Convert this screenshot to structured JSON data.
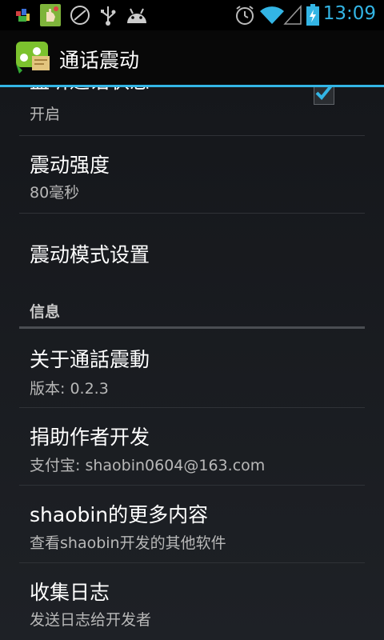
{
  "statusbar": {
    "time": "13:09",
    "left_icons": [
      "app-icon",
      "notification-icon",
      "sync-icon",
      "usb-icon",
      "android-debug-icon"
    ],
    "right_icons": [
      "alarm-icon",
      "wifi-icon",
      "signal-icon",
      "battery-icon"
    ],
    "accent": "#33b5e5"
  },
  "actionbar": {
    "title": "通话震动",
    "icon": "app-icon"
  },
  "list": {
    "partial_item": {
      "title": "监听通话状态",
      "summary": "开启",
      "checked": true
    },
    "items": [
      {
        "title": "震动强度",
        "summary": "80毫秒"
      },
      {
        "title": "震动模式设置"
      }
    ],
    "category": {
      "label": "信息"
    },
    "info_items": [
      {
        "title": "关于通話震動",
        "summary": "版本: 0.2.3"
      },
      {
        "title": "捐助作者开发",
        "summary": "支付宝: shaobin0604@163.com"
      },
      {
        "title": "shaobin的更多内容",
        "summary": "查看shaobin开发的其他软件"
      },
      {
        "title": "收集日志",
        "summary": "发送日志给开发者"
      }
    ]
  }
}
